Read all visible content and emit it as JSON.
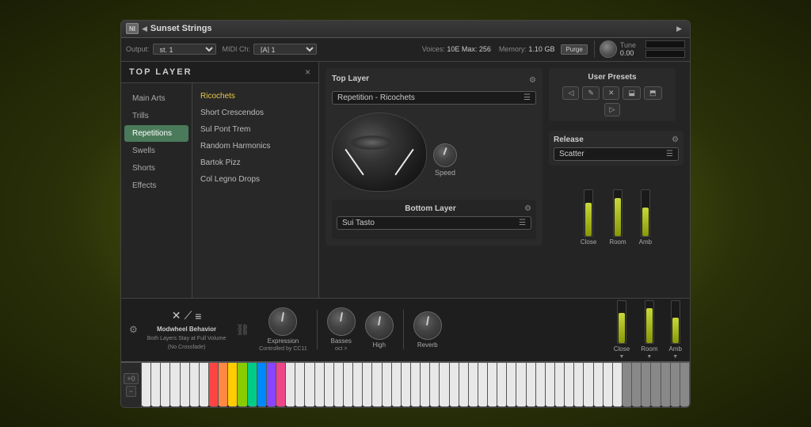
{
  "window": {
    "title": "Sunset Strings",
    "logo_alt": "NI Logo"
  },
  "info_bar": {
    "output_label": "Output:",
    "output_value": "st. 1",
    "midi_label": "MIDI Ch:",
    "midi_value": "[A] 1",
    "voices_label": "Voices:",
    "voices_value": "10E Max: 256",
    "memory_label": "Memory:",
    "memory_value": "1.10 GB",
    "purge_label": "Purge",
    "tune_label": "Tune",
    "tune_value": "0.00"
  },
  "top_layer_panel": {
    "title": "TOP LAYER",
    "close": "×",
    "nav_items": [
      {
        "id": "main-arts",
        "label": "Main Arts"
      },
      {
        "id": "trills",
        "label": "Trills"
      },
      {
        "id": "repetitions",
        "label": "Repetitions"
      },
      {
        "id": "swells",
        "label": "Swells"
      },
      {
        "id": "shorts",
        "label": "Shorts"
      },
      {
        "id": "effects",
        "label": "Effects"
      }
    ],
    "sub_items": [
      {
        "id": "ricochets",
        "label": "Ricochets"
      },
      {
        "id": "short-crescendos",
        "label": "Short Crescendos"
      },
      {
        "id": "sul-pont-trem",
        "label": "Sul Pont Trem"
      },
      {
        "id": "random-harmonics",
        "label": "Random Harmonics"
      },
      {
        "id": "bartok-pizz",
        "label": "Bartok Pizz"
      },
      {
        "id": "col-legno-drops",
        "label": "Col Legno Drops"
      }
    ]
  },
  "top_layer_control": {
    "title": "Top Layer",
    "selected": "Repetition - Ricochets",
    "speed_label": "Speed"
  },
  "user_presets": {
    "title": "User Presets",
    "buttons": [
      "◁×",
      "×",
      "×",
      "×",
      "×",
      "▷"
    ]
  },
  "release": {
    "title": "Release",
    "selected": "Scatter"
  },
  "bottom_layer": {
    "title": "Bottom Layer",
    "selected": "Sui Tasto"
  },
  "mixer": {
    "channels": [
      {
        "id": "close",
        "label": "Close",
        "fill_height": 42
      },
      {
        "id": "room",
        "label": "Room",
        "fill_height": 48
      },
      {
        "id": "amb",
        "label": "Amb",
        "fill_height": 36
      }
    ]
  },
  "bottom_controls": {
    "mod_behavior": {
      "label": "Modwheel Behavior",
      "sublabel1": "Both Layers Stay at Full Volume",
      "sublabel2": "(No Crossfade)"
    },
    "expression": {
      "label": "Expression",
      "sublabel": "Controlled by CC11"
    },
    "basses": {
      "label": "Basses",
      "sublabel": "oct >"
    },
    "high": {
      "label": "High"
    },
    "reverb": {
      "label": "Reverb"
    },
    "settings_icon": "⚙"
  },
  "keyboard": {
    "controls": [
      "+0",
      "−"
    ]
  }
}
